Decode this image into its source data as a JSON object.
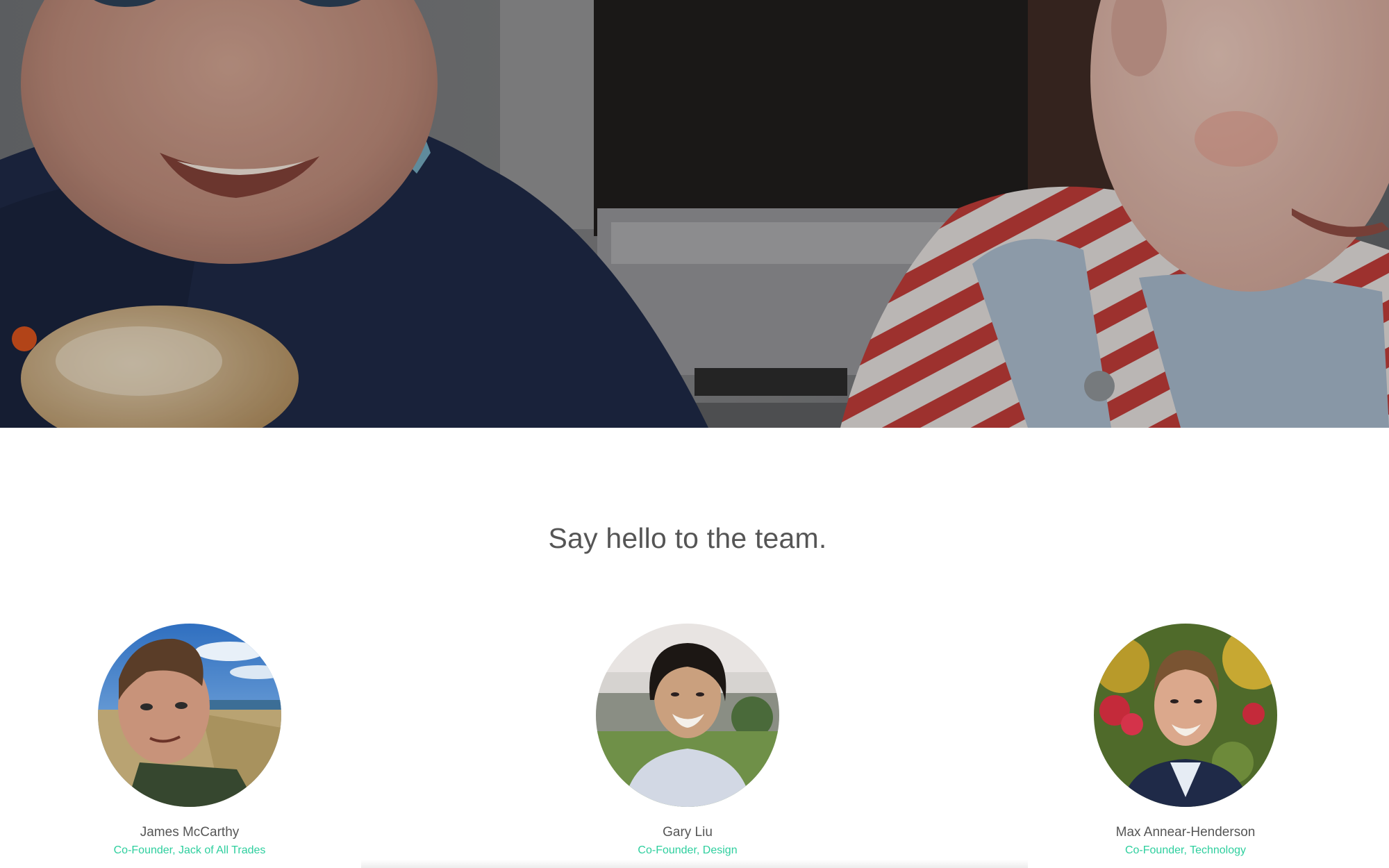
{
  "hero": {
    "image": "childhood-photo-of-two-boys"
  },
  "team": {
    "heading": "Say hello to the team.",
    "members": [
      {
        "name": "James McCarthy",
        "role": "Co-Founder, Jack of All Trades",
        "photo": "avatar-james"
      },
      {
        "name": "Gary Liu",
        "role": "Co-Founder, Design",
        "photo": "avatar-gary"
      },
      {
        "name": "Max Annear-Henderson",
        "role": "Co-Founder, Technology",
        "photo": "avatar-max"
      }
    ]
  },
  "colors": {
    "role_text": "#2ecf9e",
    "name_text": "#555555",
    "heading_text": "#555555",
    "background": "#ffffff"
  }
}
